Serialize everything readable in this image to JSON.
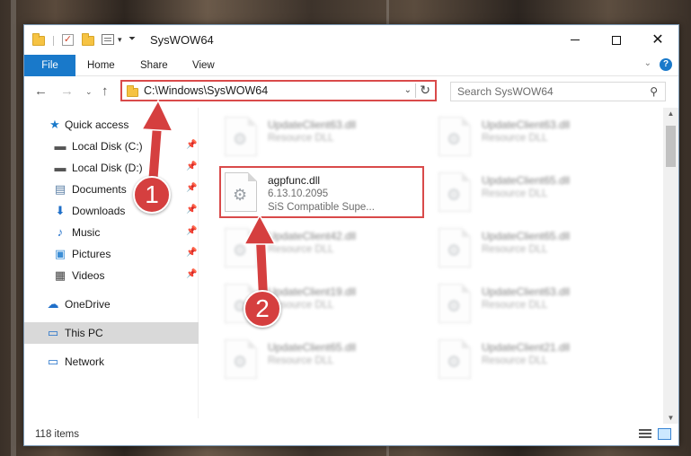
{
  "window": {
    "title": "SysWOW64",
    "minimize_label": "Minimize",
    "maximize_label": "Maximize",
    "close_label": "Close"
  },
  "ribbon": {
    "tabs": [
      "File",
      "Home",
      "Share",
      "View"
    ]
  },
  "address": {
    "path": "C:\\Windows\\SysWOW64",
    "search_placeholder": "Search SysWOW64"
  },
  "sidebar": {
    "quick_access": "Quick access",
    "items": [
      {
        "label": "Local Disk (C:)",
        "icon": "drive-icon",
        "pinned": true
      },
      {
        "label": "Local Disk (D:)",
        "icon": "drive-icon",
        "pinned": true
      },
      {
        "label": "Documents",
        "icon": "documents-icon",
        "pinned": true
      },
      {
        "label": "Downloads",
        "icon": "downloads-icon",
        "pinned": true
      },
      {
        "label": "Music",
        "icon": "music-icon",
        "pinned": true
      },
      {
        "label": "Pictures",
        "icon": "pictures-icon",
        "pinned": true
      },
      {
        "label": "Videos",
        "icon": "videos-icon",
        "pinned": true
      }
    ],
    "onedrive": "OneDrive",
    "this_pc": "This PC",
    "network": "Network"
  },
  "files": {
    "highlighted": {
      "name": "agpfunc.dll",
      "version": "6.13.10.2095",
      "description": "SiS Compatible Supe..."
    },
    "left_column": [
      {
        "name": "UpdateClient63.dll",
        "type": "Resource DLL"
      },
      {
        "name": "UpdateClient42.dll",
        "type": "Resource DLL"
      },
      {
        "name": "UpdateClient19.dll",
        "type": "Resource DLL"
      },
      {
        "name": "UpdateClient65.dll",
        "type": "Resource DLL"
      }
    ],
    "right_column": [
      {
        "name": "UpdateClient63.dll",
        "type": "Resource DLL"
      },
      {
        "name": "UpdateClient65.dll",
        "type": "Resource DLL"
      },
      {
        "name": "UpdateClient65.dll",
        "type": "Resource DLL"
      },
      {
        "name": "UpdateClient63.dll",
        "type": "Resource DLL"
      },
      {
        "name": "UpdateClient21.dll",
        "type": "Resource DLL"
      }
    ]
  },
  "status": {
    "item_count": "118 items"
  },
  "callouts": [
    "1",
    "2"
  ],
  "colors": {
    "accent": "#1979ca",
    "annotation_red": "#d53f3f",
    "selection": "#cce8ff"
  }
}
